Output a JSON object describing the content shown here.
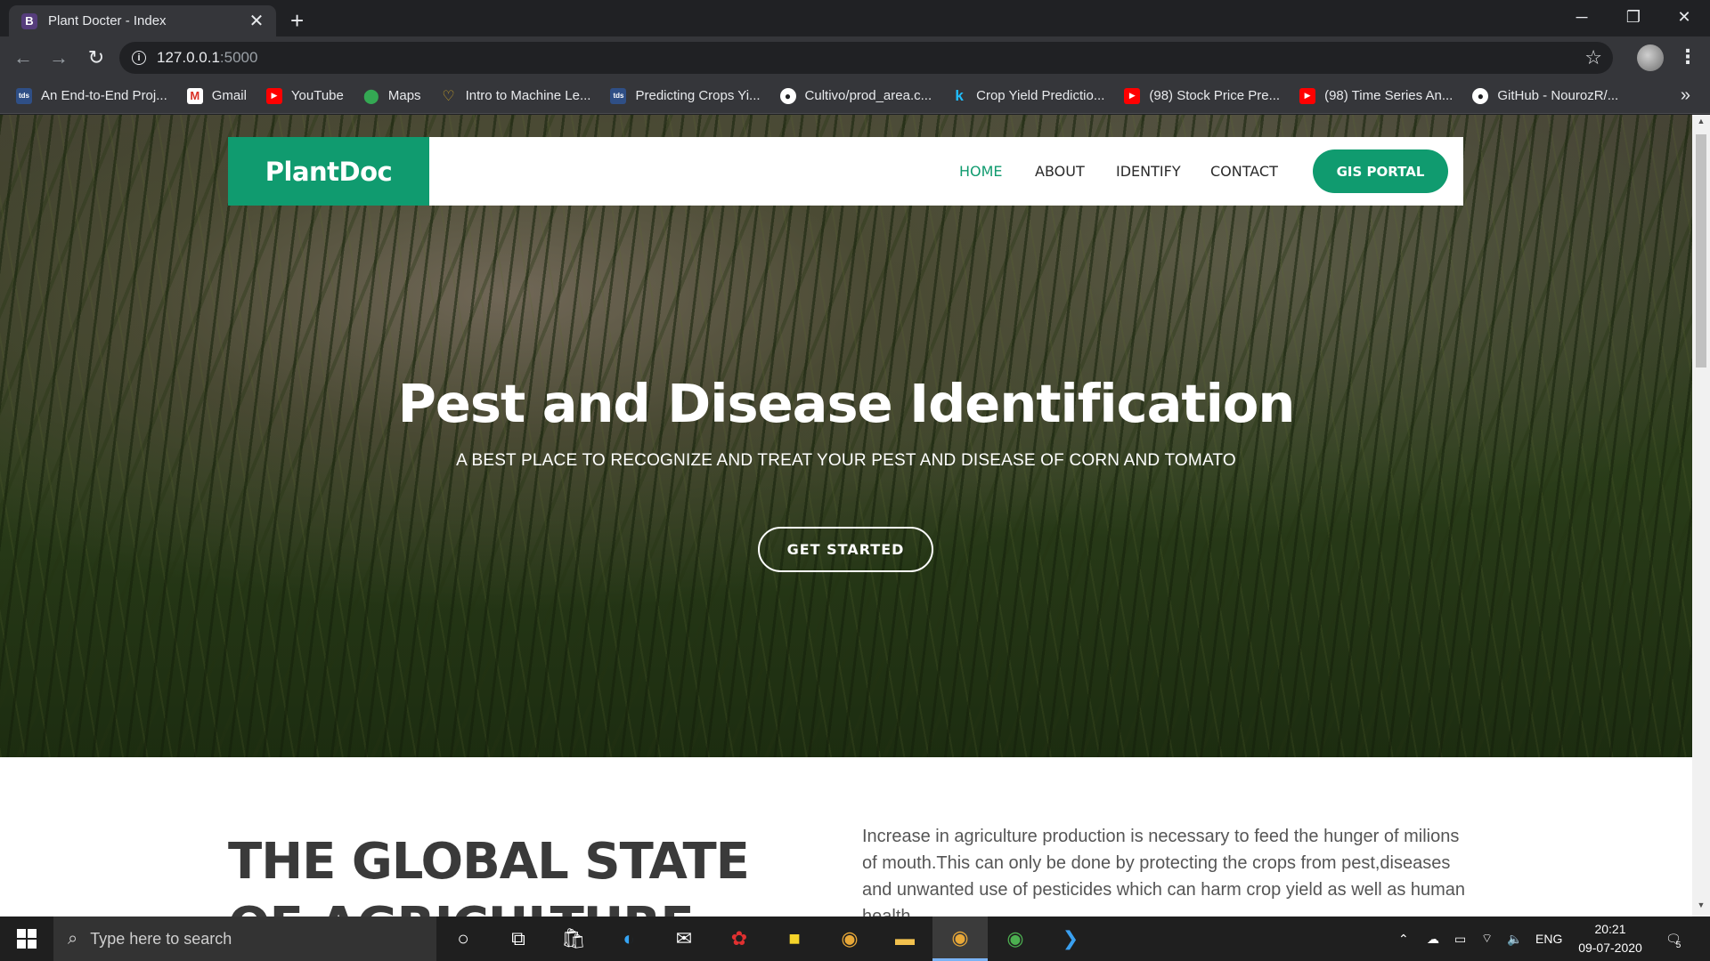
{
  "browser": {
    "tab_title": "Plant Docter - Index",
    "tab_favicon": "B",
    "url_host": "127.0.0.1",
    "url_port": ":5000",
    "bookmarks": [
      {
        "label": "An End-to-End Proj...",
        "icon": "tds-icon"
      },
      {
        "label": "Gmail",
        "icon": "gmail-icon"
      },
      {
        "label": "YouTube",
        "icon": "youtube-icon"
      },
      {
        "label": "Maps",
        "icon": "maps-icon"
      },
      {
        "label": "Intro to Machine Le...",
        "icon": "heart-icon"
      },
      {
        "label": "Predicting Crops Yi...",
        "icon": "tds-icon"
      },
      {
        "label": "Cultivo/prod_area.c...",
        "icon": "github-icon"
      },
      {
        "label": "Crop Yield Predictio...",
        "icon": "kaggle-icon"
      },
      {
        "label": "(98) Stock Price Pre...",
        "icon": "youtube-icon"
      },
      {
        "label": "(98) Time Series An...",
        "icon": "youtube-icon"
      },
      {
        "label": "GitHub - NourozR/...",
        "icon": "github-icon"
      }
    ],
    "bookmarks_more": "»"
  },
  "page": {
    "logo": "PlantDoc",
    "nav": {
      "home": "HOME",
      "about": "ABOUT",
      "identify": "IDENTIFY",
      "contact": "CONTACT",
      "gis": "GIS PORTAL"
    },
    "hero": {
      "title": "Pest and Disease Identification",
      "subtitle": "A BEST PLACE TO RECOGNIZE AND TREAT YOUR PEST AND DISEASE OF CORN AND TOMATO",
      "cta": "GET STARTED"
    },
    "about": {
      "title": "THE GLOBAL STATE OF AGRICULTURE",
      "text": "Increase in agriculture production is necessary to feed the hunger of milions of mouth.This can only be done by protecting the crops from pest,diseases and unwanted use of pesticides which can harm crop yield as well as human health."
    },
    "colors": {
      "brand": "#109b6f",
      "heading": "#3a3a3a"
    }
  },
  "taskbar": {
    "search_placeholder": "Type here to search",
    "language": "ENG",
    "time": "20:21",
    "date": "09-07-2020",
    "notifications": "5"
  }
}
